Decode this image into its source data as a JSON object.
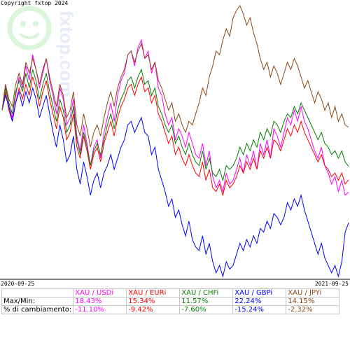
{
  "copyright": "Copyright fxtop 2024",
  "chart_data": {
    "type": "line",
    "x_start": "2020-09-25",
    "x_end": "2021-09-25",
    "grid": false,
    "watermark": "fxtop.com",
    "series": [
      {
        "name": "XAU / USDi",
        "color": "#ff00ff",
        "values": [
          0.0,
          3.5,
          0.5,
          -1.0,
          2.0,
          4.5,
          3.0,
          6.0,
          4.0,
          7.5,
          5.5,
          3.0,
          5.0,
          7.0,
          4.0,
          2.0,
          -0.5,
          3.0,
          1.5,
          -2.0,
          -1.0,
          1.5,
          -3.5,
          -5.5,
          -2.0,
          -4.5,
          -7.5,
          -5.0,
          -4.0,
          -6.5,
          -3.0,
          -1.0,
          1.0,
          -1.5,
          2.0,
          4.0,
          5.0,
          7.5,
          8.0,
          6.0,
          8.5,
          9.5,
          7.0,
          8.0,
          5.0,
          6.5,
          3.0,
          2.0,
          -0.5,
          -2.0,
          -1.0,
          -4.0,
          -2.5,
          -3.5,
          -5.0,
          -3.0,
          -4.5,
          -6.0,
          -6.5,
          -4.5,
          -7.5,
          -5.5,
          -9.0,
          -10.5,
          -9.5,
          -11.0,
          -8.5,
          -10.0,
          -9.5,
          -8.0,
          -6.5,
          -8.5,
          -6.0,
          -7.5,
          -5.5,
          -8.0,
          -4.5,
          -6.0,
          -4.0,
          -6.5,
          -2.5,
          -3.5,
          -5.0,
          -3.0,
          -1.0,
          -2.0,
          0.0,
          -1.5,
          0.5,
          -1.5,
          -2.5,
          -4.0,
          -5.5,
          -6.5,
          -5.0,
          -7.5,
          -8.5,
          -10.0,
          -9.0,
          -11.0,
          -9.5,
          -11.5,
          -11.1
        ]
      },
      {
        "name": "XAU / EURi",
        "color": "#ff0000",
        "values": [
          0.0,
          2.5,
          0.0,
          -1.5,
          1.0,
          3.0,
          1.5,
          3.5,
          2.0,
          4.5,
          3.0,
          0.5,
          2.5,
          4.0,
          1.5,
          -0.5,
          -2.5,
          0.5,
          -1.0,
          -4.0,
          -3.0,
          -0.5,
          -5.0,
          -6.5,
          -3.5,
          -5.5,
          -8.0,
          -6.0,
          -5.0,
          -7.0,
          -4.5,
          -3.0,
          -1.5,
          -3.5,
          -1.0,
          0.5,
          1.5,
          3.0,
          3.5,
          2.0,
          3.5,
          4.5,
          2.5,
          3.0,
          1.0,
          2.0,
          -0.5,
          -1.5,
          -3.0,
          -4.5,
          -3.5,
          -6.0,
          -5.0,
          -6.5,
          -7.5,
          -6.0,
          -7.5,
          -8.5,
          -9.0,
          -7.0,
          -9.5,
          -8.0,
          -10.5,
          -11.0,
          -10.0,
          -11.5,
          -9.5,
          -10.5,
          -10.0,
          -9.0,
          -7.5,
          -8.5,
          -7.0,
          -8.0,
          -6.5,
          -8.0,
          -5.5,
          -6.5,
          -5.0,
          -6.5,
          -4.0,
          -4.5,
          -5.5,
          -4.0,
          -2.5,
          -3.5,
          -2.0,
          -3.0,
          -1.5,
          -3.0,
          -4.0,
          -5.0,
          -6.0,
          -7.0,
          -6.0,
          -7.5,
          -8.0,
          -9.0,
          -8.5,
          -9.5,
          -8.5,
          -10.0,
          -9.42
        ]
      },
      {
        "name": "XAU / CHFi",
        "color": "#008000",
        "values": [
          0.0,
          3.0,
          1.0,
          -0.5,
          2.5,
          4.0,
          2.5,
          5.0,
          3.0,
          5.5,
          4.0,
          1.5,
          3.5,
          5.0,
          2.5,
          0.5,
          -1.5,
          1.5,
          0.0,
          -3.0,
          -2.0,
          0.5,
          -4.0,
          -6.0,
          -3.0,
          -5.0,
          -7.5,
          -5.5,
          -4.5,
          -6.0,
          -4.0,
          -2.0,
          -0.5,
          -2.5,
          0.0,
          1.5,
          2.5,
          4.0,
          4.5,
          3.0,
          4.5,
          5.5,
          3.5,
          4.0,
          2.0,
          3.0,
          0.5,
          -0.5,
          -2.0,
          -3.0,
          -2.0,
          -4.5,
          -3.5,
          -5.0,
          -6.0,
          -4.5,
          -6.0,
          -7.0,
          -7.5,
          -5.5,
          -8.0,
          -6.5,
          -8.5,
          -9.0,
          -8.0,
          -9.5,
          -7.5,
          -8.0,
          -7.5,
          -6.5,
          -5.0,
          -6.0,
          -4.5,
          -5.5,
          -4.0,
          -5.0,
          -3.0,
          -4.0,
          -2.5,
          -3.5,
          -1.5,
          -2.0,
          -3.0,
          -1.5,
          -0.5,
          -1.0,
          0.5,
          -0.5,
          1.0,
          0.0,
          -1.0,
          -2.0,
          -3.0,
          -4.0,
          -3.0,
          -4.5,
          -5.0,
          -6.0,
          -5.5,
          -6.5,
          -5.5,
          -7.0,
          -7.6
        ]
      },
      {
        "name": "XAU / GBPi",
        "color": "#0000ff",
        "values": [
          0.0,
          2.0,
          0.5,
          -1.5,
          1.0,
          2.5,
          0.5,
          2.5,
          1.0,
          3.0,
          1.5,
          -1.0,
          0.5,
          2.0,
          -0.5,
          -3.0,
          -5.0,
          -2.0,
          -4.0,
          -7.0,
          -6.0,
          -3.5,
          -8.0,
          -10.0,
          -7.0,
          -9.0,
          -11.5,
          -9.5,
          -8.5,
          -10.5,
          -8.5,
          -7.5,
          -6.0,
          -8.0,
          -6.5,
          -5.0,
          -4.0,
          -2.0,
          -1.5,
          -3.0,
          -2.0,
          -1.0,
          -3.0,
          -3.5,
          -6.0,
          -5.0,
          -8.0,
          -9.5,
          -11.0,
          -13.0,
          -12.0,
          -14.5,
          -13.5,
          -15.5,
          -17.0,
          -15.0,
          -17.5,
          -18.5,
          -19.0,
          -17.0,
          -19.5,
          -18.0,
          -20.5,
          -22.0,
          -21.0,
          -22.5,
          -20.5,
          -21.5,
          -21.0,
          -19.5,
          -18.0,
          -19.0,
          -17.5,
          -18.5,
          -17.0,
          -18.0,
          -16.0,
          -16.5,
          -15.0,
          -16.0,
          -14.0,
          -14.5,
          -15.5,
          -14.5,
          -12.5,
          -13.5,
          -12.0,
          -13.0,
          -11.5,
          -13.5,
          -15.0,
          -16.5,
          -18.0,
          -19.5,
          -18.0,
          -20.0,
          -21.0,
          -22.0,
          -21.0,
          -22.5,
          -20.5,
          -16.5,
          -15.24
        ]
      },
      {
        "name": "XAU / JPYi",
        "color": "#8b4513",
        "values": [
          0.0,
          3.5,
          1.5,
          0.5,
          3.5,
          5.0,
          3.5,
          6.5,
          5.0,
          7.0,
          5.5,
          3.5,
          5.5,
          7.0,
          4.5,
          2.5,
          0.5,
          3.5,
          2.0,
          -1.0,
          0.0,
          2.5,
          -2.0,
          -3.5,
          -0.5,
          -2.5,
          -5.0,
          -3.0,
          -2.0,
          -3.5,
          -1.0,
          1.0,
          2.5,
          0.5,
          3.0,
          4.5,
          5.5,
          7.5,
          8.0,
          6.5,
          8.0,
          9.0,
          7.0,
          7.5,
          5.5,
          6.5,
          4.0,
          3.0,
          1.5,
          0.0,
          1.0,
          -1.5,
          -0.5,
          -2.0,
          -3.0,
          -1.5,
          -2.0,
          -0.5,
          1.0,
          3.0,
          2.0,
          4.5,
          6.0,
          8.0,
          7.5,
          9.5,
          11.0,
          10.0,
          12.5,
          13.5,
          14.15,
          13.0,
          11.5,
          12.5,
          10.5,
          9.0,
          7.0,
          5.5,
          6.5,
          4.5,
          6.0,
          5.0,
          3.5,
          5.0,
          6.5,
          5.5,
          7.0,
          6.0,
          4.5,
          3.0,
          4.0,
          2.5,
          1.0,
          2.5,
          1.5,
          0.0,
          1.0,
          -1.0,
          0.5,
          -1.5,
          -0.5,
          -2.0,
          -2.32
        ]
      }
    ]
  },
  "stats": {
    "row_labels": [
      "Max/Min:",
      "% di cambiamento:"
    ],
    "columns": [
      {
        "name": "XAU / USDi",
        "color": "#ff00ff",
        "maxmin": "18.43%",
        "change": "-11.10%"
      },
      {
        "name": "XAU / EURi",
        "color": "#ff0000",
        "maxmin": "15.34%",
        "change": "-9.42%"
      },
      {
        "name": "XAU / CHFi",
        "color": "#008000",
        "maxmin": "11.57%",
        "change": "-7.60%"
      },
      {
        "name": "XAU / GBPi",
        "color": "#0000ff",
        "maxmin": "22.24%",
        "change": "-15.24%"
      },
      {
        "name": "XAU / JPYi",
        "color": "#8b4513",
        "maxmin": "14.15%",
        "change": "-2.32%"
      }
    ]
  }
}
